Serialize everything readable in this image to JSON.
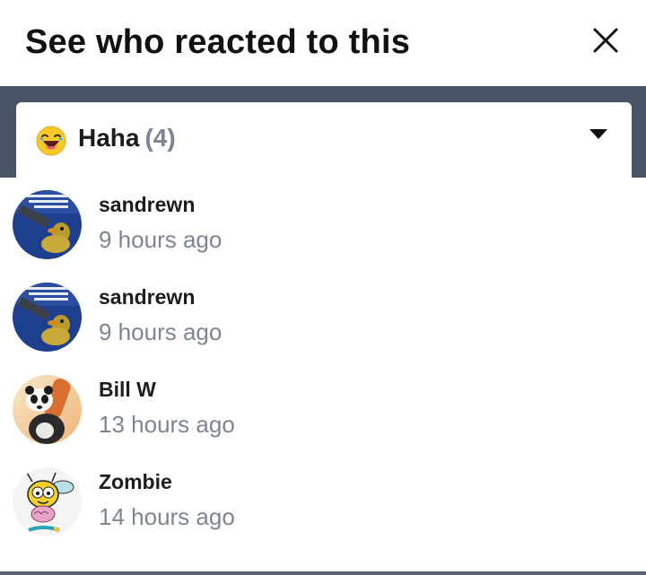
{
  "dialog": {
    "title": "See who reacted to this",
    "close_icon": "close-icon"
  },
  "reaction_selector": {
    "emoji": "laughing-emoji-icon",
    "label": "Haha",
    "count": "(4)",
    "caret_icon": "caret-down-icon"
  },
  "reactions": [
    {
      "name": "sandrewn",
      "time": "9 hours ago",
      "avatar": "duck-meme-avatar"
    },
    {
      "name": "sandrewn",
      "time": "9 hours ago",
      "avatar": "duck-meme-avatar"
    },
    {
      "name": "Bill W",
      "time": "13 hours ago",
      "avatar": "panda-avatar"
    },
    {
      "name": "Zombie",
      "time": "14 hours ago",
      "avatar": "zombee-avatar"
    }
  ],
  "colors": {
    "band": "#4a5467",
    "muted_text": "#7d8594",
    "count_text": "#7b8494"
  }
}
